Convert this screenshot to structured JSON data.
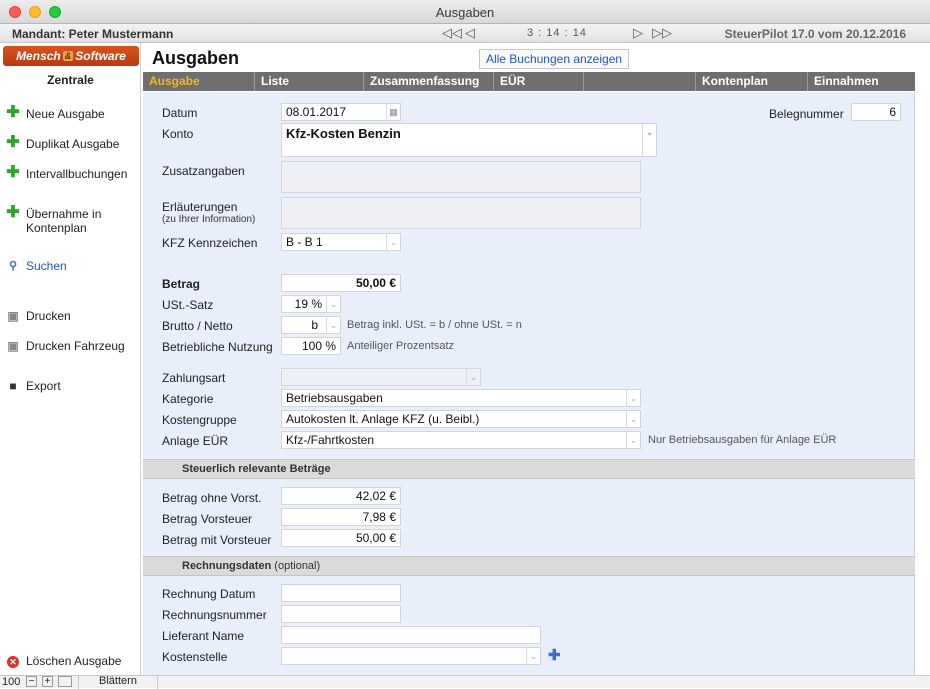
{
  "window": {
    "title": "Ausgaben"
  },
  "infobar": {
    "mandant": "Mandant: Peter Mustermann",
    "clock": "3 : 14 : 14",
    "version": "SteuerPilot 17.0 vom 20.12.2016"
  },
  "sidebar": {
    "logo_left": "Mensch",
    "logo_amp": "&",
    "logo_right": "Software",
    "heading": "Zentrale",
    "items": {
      "neue_ausgabe": "Neue Ausgabe",
      "duplikat": "Duplikat Ausgabe",
      "intervall": "Intervallbuchungen",
      "uebernahme": "Übernahme in Kontenplan",
      "suchen": "Suchen",
      "drucken": "Drucken",
      "drucken_fahrzeug": "Drucken Fahrzeug",
      "export": "Export",
      "loeschen": "Löschen Ausgabe"
    }
  },
  "header": {
    "title": "Ausgaben",
    "all_bookings_button": "Alle Buchungen anzeigen"
  },
  "tabs": {
    "ausgabe": "Ausgabe",
    "liste": "Liste",
    "zusammenfassung": "Zusammenfassung",
    "eur": "EÜR",
    "kontenplan": "Kontenplan",
    "einnahmen": "Einnahmen"
  },
  "form": {
    "datum_label": "Datum",
    "datum_value": "08.01.2017",
    "belegnummer_label": "Belegnummer",
    "belegnummer_value": "6",
    "konto_label": "Konto",
    "konto_value": "Kfz-Kosten Benzin",
    "zusatz_label": "Zusatzangaben",
    "erl_label": "Erläuterungen",
    "erl_sub": "(zu Ihrer Information)",
    "kfz_label": "KFZ Kennzeichen",
    "kfz_value": "B - B 1",
    "betrag_label": "Betrag",
    "betrag_value": "50,00 €",
    "ust_label": "USt.-Satz",
    "ust_value": "19 %",
    "brutto_label": "Brutto / Netto",
    "brutto_value": "b",
    "brutto_hint": "Betrag inkl. USt. = b / ohne USt. = n",
    "nutzung_label": "Betriebliche Nutzung",
    "nutzung_value": "100 %",
    "nutzung_hint": "Anteiliger Prozentsatz",
    "zahlungsart_label": "Zahlungsart",
    "kategorie_label": "Kategorie",
    "kategorie_value": "Betriebsausgaben",
    "kostengruppe_label": "Kostengruppe",
    "kostengruppe_value": "Autokosten lt. Anlage KFZ (u. Beibl.)",
    "anlage_label": "Anlage EÜR",
    "anlage_value": "Kfz-/Fahrtkosten",
    "anlage_hint": "Nur Betriebsausgaben für Anlage EÜR"
  },
  "steuer": {
    "section_title": "Steuerlich relevante Beträge",
    "ohne_label": "Betrag ohne Vorst.",
    "ohne_value": "42,02 €",
    "vorsteuer_label": "Betrag Vorsteuer",
    "vorsteuer_value": "7,98 €",
    "mit_label": "Betrag mit Vorsteuer",
    "mit_value": "50,00 €"
  },
  "rechnung": {
    "section_title": "Rechnungsdaten",
    "section_optional": "(optional)",
    "datum_label": "Rechnung Datum",
    "nummer_label": "Rechnungsnummer",
    "lieferant_label": "Lieferant Name",
    "kostenstelle_label": "Kostenstelle"
  },
  "statusbar": {
    "zoom": "100",
    "mode": "Blättern"
  },
  "colors": {
    "accent_tab": "#f5b521",
    "link": "#1f55c8",
    "form_bg": "#e9eefb",
    "tabbar": "#6e6e6e"
  }
}
